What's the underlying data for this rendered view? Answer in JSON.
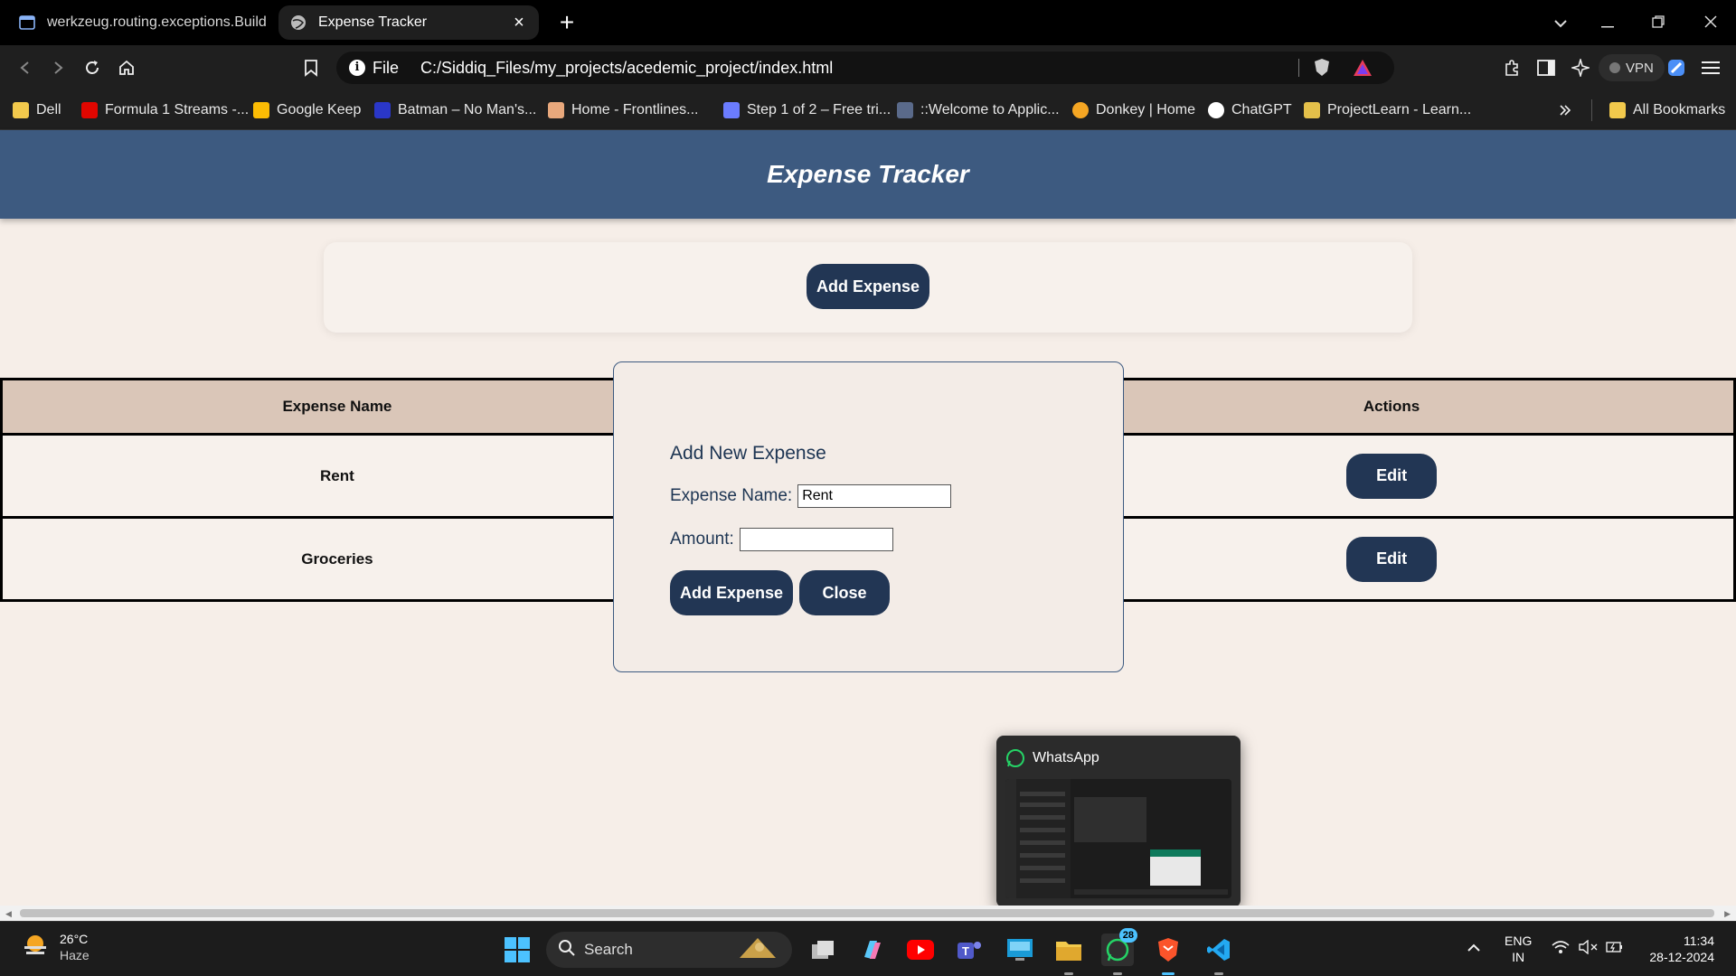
{
  "browser": {
    "tabs": [
      {
        "title": "werkzeug.routing.exceptions.BuildEr",
        "active": false
      },
      {
        "title": "Expense Tracker",
        "active": true
      }
    ],
    "url_scheme": "File",
    "url": "C:/Siddiq_Files/my_projects/acedemic_project/index.html",
    "vpn_label": "VPN",
    "bookmarks": [
      {
        "label": "Dell",
        "icon": "folder-icon"
      },
      {
        "label": "Formula 1 Streams -...",
        "icon": "f1-icon"
      },
      {
        "label": "Google Keep",
        "icon": "keep-icon"
      },
      {
        "label": "Batman – No Man's...",
        "icon": "batman-icon"
      },
      {
        "label": "Home - Frontlines...",
        "icon": "frontlines-icon"
      },
      {
        "label": "Step 1 of 2 – Free tri...",
        "icon": "step-icon"
      },
      {
        "label": "::Welcome to Applic...",
        "icon": "welcome-icon"
      },
      {
        "label": "Donkey | Home",
        "icon": "donkey-icon"
      },
      {
        "label": "ChatGPT",
        "icon": "chatgpt-icon"
      },
      {
        "label": "ProjectLearn - Learn...",
        "icon": "projectlearn-icon"
      }
    ],
    "all_bookmarks_label": "All Bookmarks"
  },
  "app": {
    "title": "Expense Tracker",
    "add_expense_button": "Add Expense",
    "table": {
      "headers": [
        "Expense Name",
        "Actions"
      ],
      "rows": [
        {
          "name": "Rent",
          "action": "Edit"
        },
        {
          "name": "Groceries",
          "action": "Edit"
        }
      ]
    },
    "modal": {
      "title": "Add New Expense",
      "name_label": "Expense Name:",
      "name_value": "Rent",
      "amount_label": "Amount:",
      "amount_value": "",
      "submit_label": "Add Expense",
      "close_label": "Close"
    }
  },
  "whatsapp_preview": {
    "title": "WhatsApp"
  },
  "taskbar": {
    "weather_temp": "26°C",
    "weather_desc": "Haze",
    "search_label": "Search",
    "whatsapp_badge": "28",
    "language": "ENG",
    "region": "IN",
    "time": "11:34",
    "date": "28-12-2024"
  },
  "colors": {
    "header_bg": "#3d5a80",
    "button_bg": "#223654",
    "page_bg": "#f6eee8",
    "table_header_bg": "#dac6b8"
  }
}
